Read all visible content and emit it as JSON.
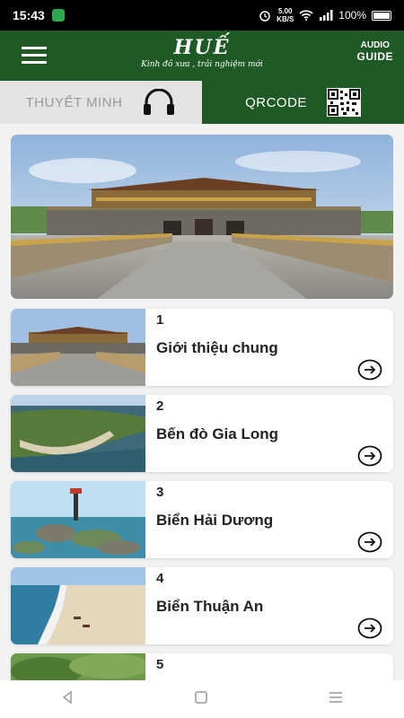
{
  "status_bar": {
    "time": "15:43",
    "net_speed_value": "5.00",
    "net_speed_unit": "KB/S",
    "battery": "100%"
  },
  "header": {
    "title": "HUẾ",
    "slogan": "Kinh đô xưa , trải nghiệm mới",
    "audio_label": "AUDIO",
    "guide_label": "GUIDE"
  },
  "tabs": [
    {
      "label": "THUYẾT MINH",
      "icon": "headphones-icon"
    },
    {
      "label": "QRCODE",
      "icon": "qrcode-icon"
    }
  ],
  "places": [
    {
      "num": "1",
      "name": "Giới thiệu chung"
    },
    {
      "num": "2",
      "name": "Bến đò Gia Long"
    },
    {
      "num": "3",
      "name": "Biển Hải Dương"
    },
    {
      "num": "4",
      "name": "Biển Thuận An"
    },
    {
      "num": "5",
      "name": ""
    }
  ],
  "colors": {
    "brand_green": "#1f5a26",
    "tab_inactive": "#e3e3e3"
  }
}
